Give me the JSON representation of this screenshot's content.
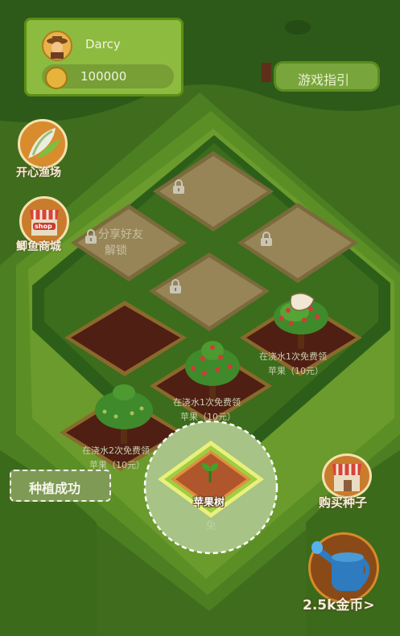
{
  "player": {
    "name": "Darcy",
    "coins": "100000"
  },
  "guide_button": {
    "label": "游戏指引"
  },
  "side_menu": {
    "happy_fishing": "开心渔场",
    "fish_shop": "鲫鱼商城",
    "shop_sign": "shop"
  },
  "plots": {
    "share_unlock_line1": "分享好友",
    "share_unlock_line2": "解锁",
    "right_tree_line1": "在浇水1次免费领",
    "right_tree_line2": "苹果（10元）",
    "middle_tree_line1": "在浇水1次免费领",
    "middle_tree_line2": "苹果（10元）",
    "left_tree_line1": "在浇水2次免费领",
    "left_tree_line2": "苹果（10元）",
    "hidden_label": "免"
  },
  "toast": {
    "text": "种植成功"
  },
  "highlight": {
    "label": "苹果树"
  },
  "buy_seeds": {
    "label": "购买种子"
  },
  "watering": {
    "cost": "2.5k金币>"
  }
}
